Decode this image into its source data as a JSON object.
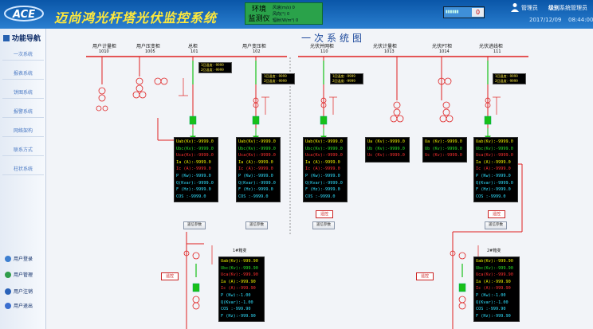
{
  "app": {
    "title": "迈尚鸿光杆塔光伏监控系统",
    "logo_text": "ACE"
  },
  "env_monitor": {
    "label_line1": "环境",
    "label_line2": "监测仪",
    "rows": [
      {
        "label": "风速(m/s)",
        "value": "0"
      },
      {
        "label": "风向(°)",
        "value": "0"
      },
      {
        "label": "辐射(W/m²)",
        "value": "0"
      }
    ]
  },
  "alarm": {
    "count": "0"
  },
  "user": {
    "role": "管理员",
    "level_label": "级别",
    "level_value": "系统管理员",
    "date": "2017/12/09",
    "time": "08:44:00.6"
  },
  "sidebar": {
    "title": "功能导航",
    "items": [
      {
        "label": "一次系统"
      },
      {
        "label": "报表系统"
      },
      {
        "label": "饼图系统"
      },
      {
        "label": "报警系统"
      },
      {
        "label": "网络架构"
      },
      {
        "label": "联系方式"
      },
      {
        "label": "柱状系统"
      }
    ],
    "user_links": [
      {
        "label": "用户登录"
      },
      {
        "label": "用户管理"
      },
      {
        "label": "用户注销"
      },
      {
        "label": "用户退出"
      }
    ]
  },
  "main": {
    "title": "一次系统图",
    "feeders": [
      {
        "label": "用户计量柜",
        "code": "1010"
      },
      {
        "label": "用户压变柜",
        "code": "1005"
      },
      {
        "label": "总柜",
        "code": "101"
      },
      {
        "label": "用户变压柜",
        "code": "102"
      },
      {
        "label": "光伏并网柜",
        "code": "110"
      },
      {
        "label": "光伏计量柜",
        "code": "1013"
      },
      {
        "label": "光伏PT柜",
        "code": "1014"
      },
      {
        "label": "光伏进线柜",
        "code": "111"
      }
    ],
    "temp_boxes": [
      {
        "l1": "1回温度: -9999",
        "l2": "2回温度: -9999"
      },
      {
        "l1": "1回温度: -9999",
        "l2": "2回温度: -9999"
      },
      {
        "l1": "1回温度: -9999",
        "l2": "2回温度: -9999"
      },
      {
        "l1": "1回温度: -9999",
        "l2": "2回温度: -9999"
      }
    ],
    "meters": {
      "m101": [
        {
          "t": "Uab(Kv):",
          "v": "-9999.0",
          "c": "#f0f000"
        },
        {
          "t": "Ubc(Kv):",
          "v": "-9999.0",
          "c": "#28e028"
        },
        {
          "t": "Uca(Kv):",
          "v": "-9999.0",
          "c": "#ff3030"
        },
        {
          "t": "Ia  (A):",
          "v": "-9999.0",
          "c": "#f0f000"
        },
        {
          "t": "Ic  (A):",
          "v": "-9999.0",
          "c": "#ff3030"
        },
        {
          "t": "P  (Kw):",
          "v": "-9999.0",
          "c": "#30e0ff"
        },
        {
          "t": "Q(Kvar):",
          "v": "-9999.0",
          "c": "#30e0ff"
        },
        {
          "t": "F  (Hz):",
          "v": "-9999.0",
          "c": "#30e0ff"
        },
        {
          "t": "COS    :",
          "v": "-9999.0",
          "c": "#30e0ff"
        }
      ],
      "m102": [
        {
          "t": "Uab(Kv):",
          "v": "-9999.0",
          "c": "#f0f000"
        },
        {
          "t": "Ubc(Kv):",
          "v": "-9999.0",
          "c": "#28e028"
        },
        {
          "t": "Uca(Kv):",
          "v": "-9999.0",
          "c": "#ff3030"
        },
        {
          "t": "Ia  (A):",
          "v": "-9999.0",
          "c": "#f0f000"
        },
        {
          "t": "Ic  (A):",
          "v": "-9999.0",
          "c": "#ff3030"
        },
        {
          "t": "P  (Kw):",
          "v": "-9999.0",
          "c": "#30e0ff"
        },
        {
          "t": "Q(Kvar):",
          "v": "-9999.0",
          "c": "#30e0ff"
        },
        {
          "t": "F  (Hz):",
          "v": "-9999.0",
          "c": "#30e0ff"
        },
        {
          "t": "COS    :",
          "v": "-9999.0",
          "c": "#30e0ff"
        }
      ],
      "m110": [
        {
          "t": "Uab(Kv):",
          "v": "-9999.0",
          "c": "#f0f000"
        },
        {
          "t": "Ubc(Kv):",
          "v": "-9999.0",
          "c": "#28e028"
        },
        {
          "t": "Uca(Kv):",
          "v": "-9999.0",
          "c": "#ff3030"
        },
        {
          "t": "Ia  (A):",
          "v": "-9999.0",
          "c": "#f0f000"
        },
        {
          "t": "Ic  (A):",
          "v": "-9999.0",
          "c": "#ff3030"
        },
        {
          "t": "P  (Kw):",
          "v": "-9999.0",
          "c": "#30e0ff"
        },
        {
          "t": "Q(Kvar):",
          "v": "-9999.0",
          "c": "#30e0ff"
        },
        {
          "t": "F  (Hz):",
          "v": "-9999.0",
          "c": "#30e0ff"
        },
        {
          "t": "COS    :",
          "v": "-9999.0",
          "c": "#30e0ff"
        }
      ],
      "m1013": [
        {
          "t": "Ua (Kv):",
          "v": "-9999.0",
          "c": "#f0f000"
        },
        {
          "t": "Ub (Kv):",
          "v": "-9999.0",
          "c": "#28e028"
        },
        {
          "t": "Uc (Kv):",
          "v": "-9999.0",
          "c": "#ff3030"
        }
      ],
      "m1014": [
        {
          "t": "Ua (Kv):",
          "v": "-9999.0",
          "c": "#f0f000"
        },
        {
          "t": "Ub (Kv):",
          "v": "-9999.0",
          "c": "#28e028"
        },
        {
          "t": "Uc (Kv):",
          "v": "-9999.0",
          "c": "#ff3030"
        }
      ],
      "m111": [
        {
          "t": "Uab(Kv):",
          "v": "-9999.0",
          "c": "#f0f000"
        },
        {
          "t": "Ubc(Kv):",
          "v": "-9999.0",
          "c": "#28e028"
        },
        {
          "t": "Uca(Kv):",
          "v": "-9999.0",
          "c": "#ff3030"
        },
        {
          "t": "Ia  (A):",
          "v": "-9999.0",
          "c": "#f0f000"
        },
        {
          "t": "Ic  (A):",
          "v": "-9999.0",
          "c": "#ff3030"
        },
        {
          "t": "P  (Kw):",
          "v": "-9999.0",
          "c": "#30e0ff"
        },
        {
          "t": "Q(Kvar):",
          "v": "-9999.0",
          "c": "#30e0ff"
        },
        {
          "t": "F  (Hz):",
          "v": "-9999.0",
          "c": "#30e0ff"
        },
        {
          "t": "COS    :",
          "v": "-9999.0",
          "c": "#30e0ff"
        }
      ],
      "tx1": [
        {
          "t": "Uab(Kv):",
          "v": "-999.90",
          "c": "#f0f000"
        },
        {
          "t": "Ubc(Kv):",
          "v": "-999.90",
          "c": "#28e028"
        },
        {
          "t": "Uca(Kv):",
          "v": "-999.90",
          "c": "#ff3030"
        },
        {
          "t": "Ia  (A):",
          "v": "-999.90",
          "c": "#f0f000"
        },
        {
          "t": "Ic  (A):",
          "v": "-999.90",
          "c": "#ff3030"
        },
        {
          "t": "P  (Kw):",
          "v": "-1.00",
          "c": "#30e0ff"
        },
        {
          "t": "Q(Kvar):",
          "v": "-1.00",
          "c": "#30e0ff"
        },
        {
          "t": "COS    :",
          "v": "-999.90",
          "c": "#30e0ff"
        },
        {
          "t": "F  (Hz):",
          "v": "-999.90",
          "c": "#30e0ff"
        }
      ],
      "tx2": [
        {
          "t": "Uab(Kv):",
          "v": "-999.90",
          "c": "#f0f000"
        },
        {
          "t": "Ubc(Kv):",
          "v": "-999.90",
          "c": "#28e028"
        },
        {
          "t": "Uca(Kv):",
          "v": "-999.90",
          "c": "#ff3030"
        },
        {
          "t": "Ia  (A):",
          "v": "-999.90",
          "c": "#f0f000"
        },
        {
          "t": "Ic  (A):",
          "v": "-999.90",
          "c": "#ff3030"
        },
        {
          "t": "P  (Kw):",
          "v": "-1.00",
          "c": "#30e0ff"
        },
        {
          "t": "Q(Kvar):",
          "v": "-1.00",
          "c": "#30e0ff"
        },
        {
          "t": "COS    :",
          "v": "-999.90",
          "c": "#30e0ff"
        },
        {
          "t": "F  (Hz):",
          "v": "-999.90",
          "c": "#30e0ff"
        }
      ]
    },
    "remote_label": "遥控",
    "param_label": "遥信参数",
    "transformers": [
      {
        "label": "1#箱变"
      },
      {
        "label": "2#箱变"
      }
    ]
  },
  "colors": {
    "header_bg": "#0a56a8",
    "title_yellow": "#ffe93b",
    "bus_red": "#e02020",
    "live_green": "#18c018",
    "env_green": "#2aa24a"
  }
}
